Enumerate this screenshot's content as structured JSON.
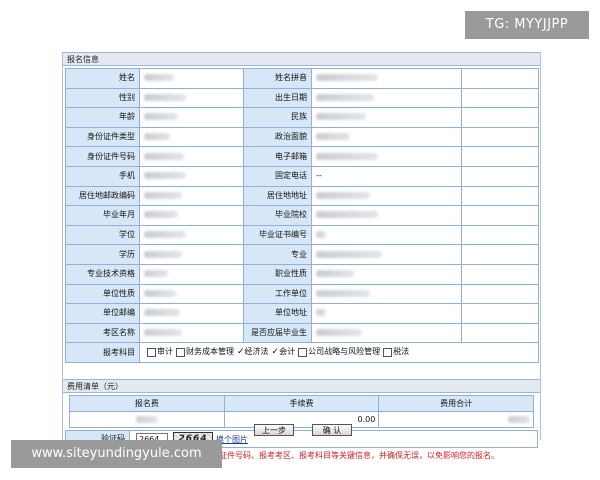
{
  "section_title": "报名信息",
  "fields": [
    {
      "l1": "姓名",
      "v1": "",
      "l2": "姓名拼音",
      "v2": ""
    },
    {
      "l1": "性别",
      "v1": "",
      "l2": "出生日期",
      "v2": ""
    },
    {
      "l1": "年龄",
      "v1": "",
      "l2": "民族",
      "v2": ""
    },
    {
      "l1": "身份证件类型",
      "v1": "",
      "l2": "政治面貌",
      "v2": ""
    },
    {
      "l1": "身份证件号码",
      "v1": "",
      "l2": "电子邮箱",
      "v2": ""
    },
    {
      "l1": "手机",
      "v1": "",
      "l2": "固定电话",
      "v2": "--"
    },
    {
      "l1": "居住地邮政编码",
      "v1": "",
      "l2": "居住地地址",
      "v2": ""
    },
    {
      "l1": "毕业年月",
      "v1": "",
      "l2": "毕业院校",
      "v2": ""
    },
    {
      "l1": "学位",
      "v1": "",
      "l2": "毕业证书编号",
      "v2": ""
    },
    {
      "l1": "学历",
      "v1": "",
      "l2": "专业",
      "v2": ""
    },
    {
      "l1": "专业技术资格",
      "v1": "",
      "l2": "职业性质",
      "v2": ""
    },
    {
      "l1": "单位性质",
      "v1": "",
      "l2": "工作单位",
      "v2": ""
    },
    {
      "l1": "单位邮编",
      "v1": "",
      "l2": "单位地址",
      "v2": ""
    },
    {
      "l1": "考区名称",
      "v1": "",
      "l2": "是否应届毕业生",
      "v2": ""
    }
  ],
  "subjects_label": "报考科目",
  "subjects": [
    {
      "name": "审计",
      "checked": false
    },
    {
      "name": "财务成本管理",
      "checked": false
    },
    {
      "name": "经济法",
      "checked": true
    },
    {
      "name": "会计",
      "checked": true
    },
    {
      "name": "公司战略与风险管理",
      "checked": false
    },
    {
      "name": "税法",
      "checked": false
    }
  ],
  "fee_title": "费用清单（元）",
  "fee_headers": [
    "报名费",
    "手续费",
    "费用合计"
  ],
  "fee_values": [
    "",
    "0.00",
    ""
  ],
  "captcha_label": "验证码",
  "captcha_value": "2664",
  "captcha_image_text": "2664",
  "captcha_link": "换个图片",
  "warning": "请仔细确认您的姓名、身份证件类型、身份证件号码、报考考区、报考科目等关键信息，并确保无误，以免影响您的报名。",
  "buttons": {
    "prev": "上一步",
    "confirm": "确 认"
  },
  "watermark_tg": "TG: MYYJJPP",
  "watermark_site": "www.siteyundingyule.com"
}
